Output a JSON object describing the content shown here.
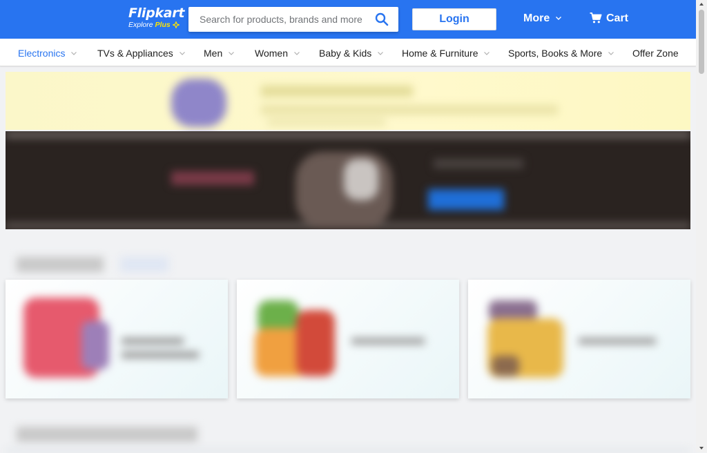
{
  "header": {
    "logo_text": "Flipkart",
    "logo_sub_explore": "Explore",
    "logo_sub_plus": "Plus",
    "search_placeholder": "Search for products, brands and more",
    "login_label": "Login",
    "more_label": "More",
    "cart_label": "Cart"
  },
  "categories": [
    {
      "label": "Electronics",
      "active": true
    },
    {
      "label": "TVs & Appliances"
    },
    {
      "label": "Men"
    },
    {
      "label": "Women"
    },
    {
      "label": "Baby & Kids"
    },
    {
      "label": "Home & Furniture"
    },
    {
      "label": "Sports, Books & More"
    },
    {
      "label": "Offer Zone"
    }
  ],
  "colors": {
    "brand_blue": "#2874f0",
    "plus_yellow": "#ffe500",
    "page_bg": "#f1f2f4"
  },
  "icons": {
    "search": "search-icon",
    "cart": "cart-icon",
    "chevron": "chevron-down-icon",
    "plus_logo": "plus-icon"
  }
}
